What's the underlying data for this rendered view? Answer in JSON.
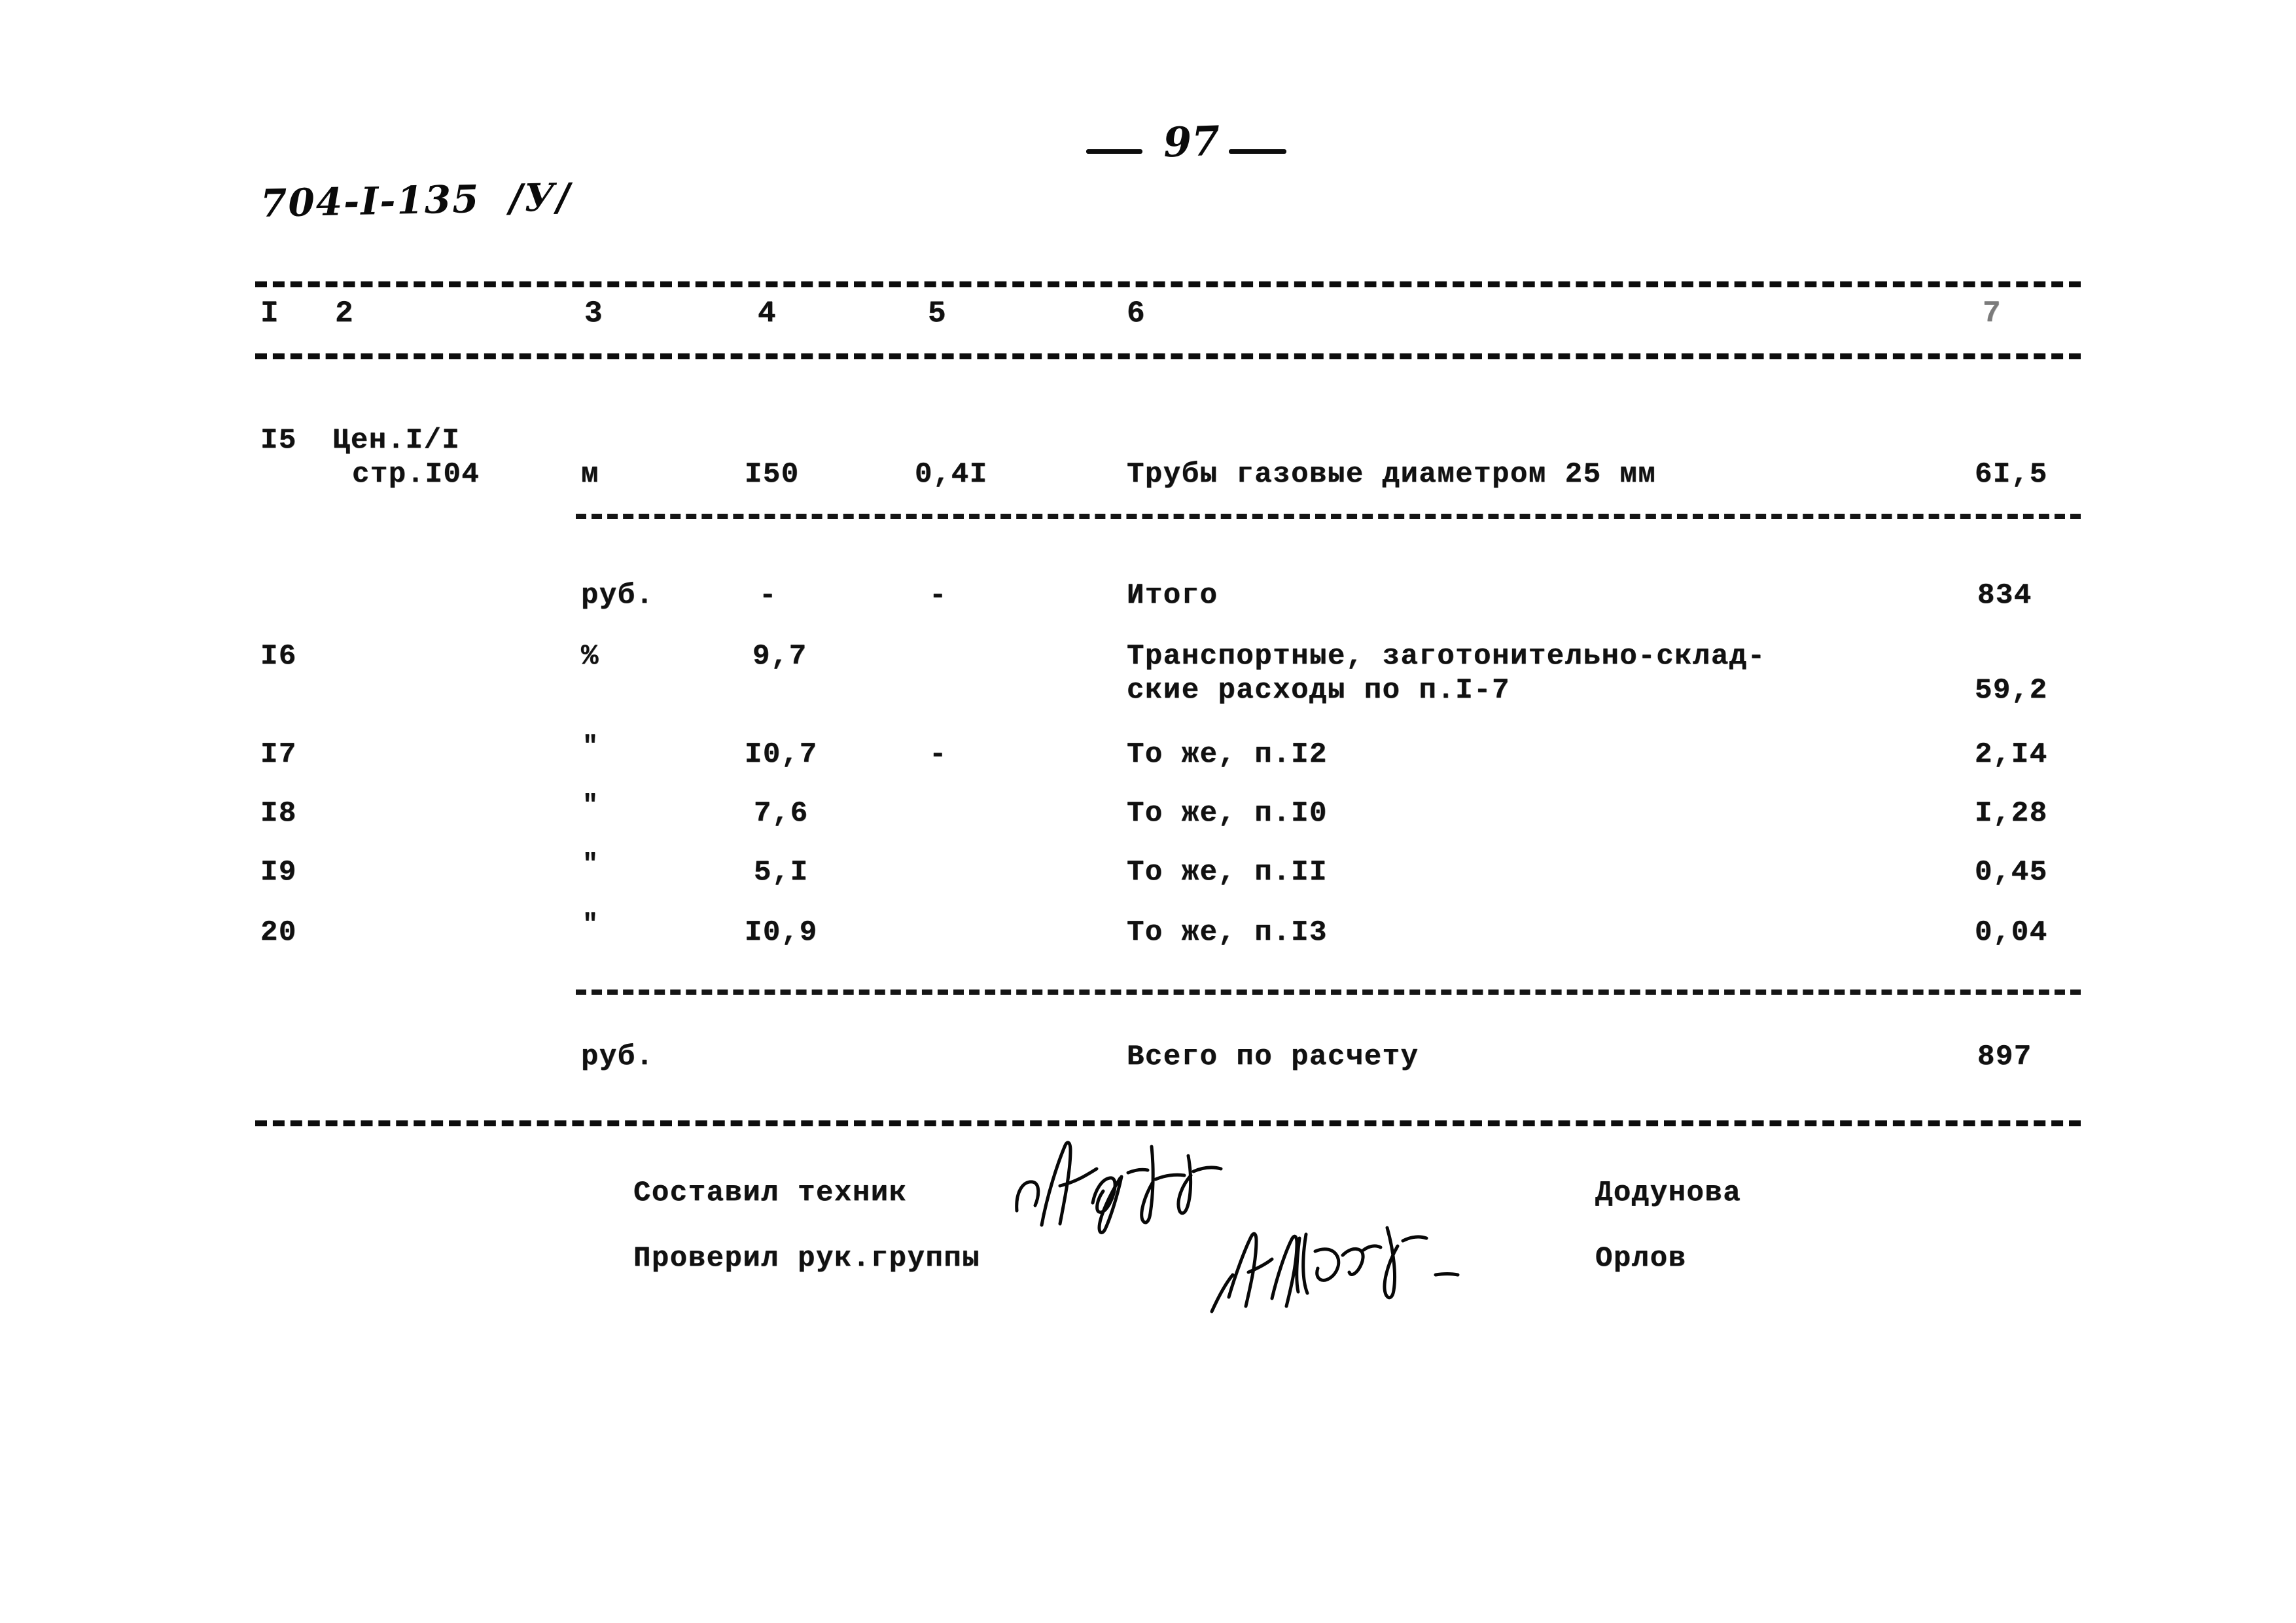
{
  "document": {
    "page_number": "97",
    "doc_code": "704-I-135  /У/"
  },
  "table": {
    "column_headers": [
      "I",
      "2",
      "3",
      "4",
      "5",
      "6",
      "7"
    ],
    "rows": [
      {
        "num": "I5",
        "source": "Цен.I/I",
        "source_line2": "стр.I04",
        "unit": "м",
        "qty": "I50",
        "price": "0,4I",
        "description": "Трубы газовые диаметром 25 мм",
        "description_line2": "",
        "total": "6I,5"
      },
      {
        "num": "",
        "source": "",
        "source_line2": "",
        "unit": "руб.",
        "qty": "-",
        "price": "-",
        "description": "Итого",
        "description_line2": "",
        "total": "834"
      },
      {
        "num": "I6",
        "source": "",
        "source_line2": "",
        "unit": "%",
        "qty": "9,7",
        "price": "",
        "description": "Транспортные, заготонительно-склад-",
        "description_line2": "ские расходы по п.I-7",
        "total": "59,2"
      },
      {
        "num": "I7",
        "source": "",
        "source_line2": "",
        "unit": "\"",
        "qty": "I0,7",
        "price": "-",
        "description": "То же, п.I2",
        "description_line2": "",
        "total": "2,I4"
      },
      {
        "num": "I8",
        "source": "",
        "source_line2": "",
        "unit": "\"",
        "qty": "7,6",
        "price": "",
        "description": "То же, п.I0",
        "description_line2": "",
        "total": "I,28"
      },
      {
        "num": "I9",
        "source": "",
        "source_line2": "",
        "unit": "\"",
        "qty": "5,I",
        "price": "",
        "description": "То же, п.II",
        "description_line2": "",
        "total": "0,45"
      },
      {
        "num": "20",
        "source": "",
        "source_line2": "",
        "unit": "\"",
        "qty": "I0,9",
        "price": "",
        "description": "То же, п.I3",
        "description_line2": "",
        "total": "0,04"
      },
      {
        "num": "",
        "source": "",
        "source_line2": "",
        "unit": "руб.",
        "qty": "",
        "price": "",
        "description": "Всего по расчету",
        "description_line2": "",
        "total": "897"
      }
    ]
  },
  "signatures": {
    "prepared_by_label": "Составил техник",
    "prepared_by_name": "Додунова",
    "checked_by_label": "Проверил рук.группы",
    "checked_by_name": "Орлов"
  }
}
